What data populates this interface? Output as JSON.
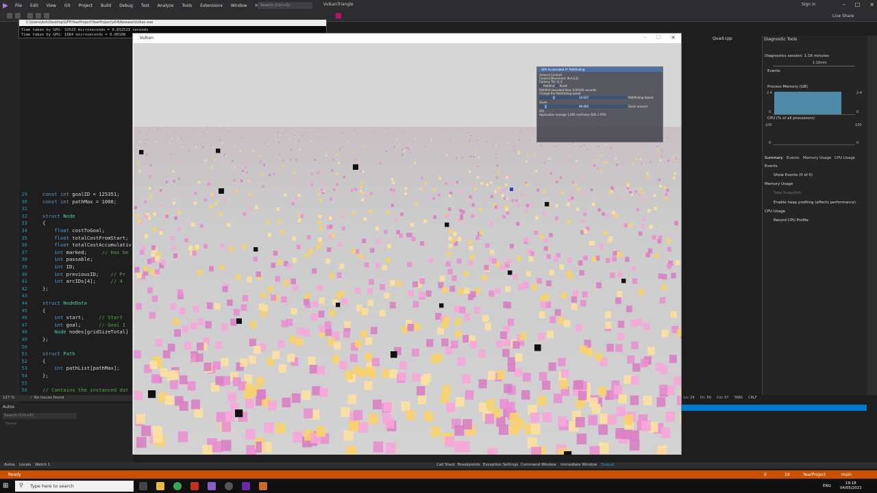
{
  "vs": {
    "menu": [
      "File",
      "Edit",
      "View",
      "Git",
      "Project",
      "Build",
      "Debug",
      "Test",
      "Analyze",
      "Tools",
      "Extensions",
      "Window",
      "Help"
    ],
    "search_placeholder": "Search (Ctrl+Q)",
    "title": "VulkanTriangle",
    "signin": "Sign in",
    "liveshare": "Live Share",
    "code_tab": "Quad.cpp"
  },
  "console": {
    "title": "C:\\Users\\Ash\\Desktop\\GFP\\YearProject\\YearProject\\x64\\Release\\Vulkan.exe",
    "lines": [
      "Time taken by GPU: 32523 microseconds = 0.032523 seconds",
      "Time taken by GPU: 1084 microseconds = 0.00108"
    ]
  },
  "vulkan": {
    "title": "Vulkan"
  },
  "imgui": {
    "title": "GPU Accelerated A* Pathfinding",
    "lines": [
      "General Controls",
      "Camera Movement: W,A,S,D",
      "Camera Tilt: Q, E",
      "Pathfind",
      "Reset",
      "Pathfind executed time: 0.00100 seconds",
      "Change the Pathfinding speed"
    ],
    "speed_value": "14.625",
    "speed_label": "Pathfinding Speed",
    "zoom_header": "Zoom",
    "zoom_value": "99.000",
    "zoom_label": "Zoom amount",
    "fps_label": "FPS",
    "fps_line": "Application average 1.692 ms/frame (591.1 FPS)"
  },
  "code": [
    {
      "ln": "29",
      "parts": [
        [
          "kw",
          "const "
        ],
        [
          "kw",
          "int "
        ],
        [
          "tx",
          "goalID = 125351;"
        ]
      ]
    },
    {
      "ln": "30",
      "parts": [
        [
          "kw",
          "const "
        ],
        [
          "kw",
          "int "
        ],
        [
          "tx",
          "pathMax = 1000;"
        ]
      ]
    },
    {
      "ln": "31",
      "parts": []
    },
    {
      "ln": "32",
      "parts": [
        [
          "kw",
          "struct "
        ],
        [
          "ty",
          "Node"
        ]
      ]
    },
    {
      "ln": "33",
      "parts": [
        [
          "tx",
          "{"
        ]
      ]
    },
    {
      "ln": "34",
      "parts": [
        [
          "tx",
          "    "
        ],
        [
          "kw",
          "float "
        ],
        [
          "tx",
          "costToGoal;"
        ]
      ]
    },
    {
      "ln": "35",
      "parts": [
        [
          "tx",
          "    "
        ],
        [
          "kw",
          "float "
        ],
        [
          "tx",
          "totalCostFromStart;"
        ]
      ]
    },
    {
      "ln": "36",
      "parts": [
        [
          "tx",
          "    "
        ],
        [
          "kw",
          "float "
        ],
        [
          "tx",
          "totalCostAccumulativ"
        ]
      ]
    },
    {
      "ln": "37",
      "parts": [
        [
          "tx",
          "    "
        ],
        [
          "kw",
          "int "
        ],
        [
          "tx",
          "marked;     "
        ],
        [
          "cm",
          "// Has be"
        ]
      ]
    },
    {
      "ln": "38",
      "parts": [
        [
          "tx",
          "    "
        ],
        [
          "kw",
          "int "
        ],
        [
          "tx",
          "passable;"
        ]
      ]
    },
    {
      "ln": "39",
      "parts": [
        [
          "tx",
          "    "
        ],
        [
          "kw",
          "int "
        ],
        [
          "tx",
          "ID;"
        ]
      ]
    },
    {
      "ln": "40",
      "parts": [
        [
          "tx",
          "    "
        ],
        [
          "kw",
          "int "
        ],
        [
          "tx",
          "previousID;    "
        ],
        [
          "cm",
          "// Pr"
        ]
      ]
    },
    {
      "ln": "41",
      "parts": [
        [
          "tx",
          "    "
        ],
        [
          "kw",
          "int "
        ],
        [
          "tx",
          "arcIDs[4];     "
        ],
        [
          "cm",
          "// 4"
        ]
      ]
    },
    {
      "ln": "42",
      "parts": [
        [
          "tx",
          "};"
        ]
      ]
    },
    {
      "ln": "43",
      "parts": []
    },
    {
      "ln": "44",
      "parts": [
        [
          "kw",
          "struct "
        ],
        [
          "ty",
          "NodeData"
        ]
      ]
    },
    {
      "ln": "45",
      "parts": [
        [
          "tx",
          "{"
        ]
      ]
    },
    {
      "ln": "46",
      "parts": [
        [
          "tx",
          "    "
        ],
        [
          "kw",
          "int "
        ],
        [
          "tx",
          "start;     "
        ],
        [
          "cm",
          "// Start"
        ]
      ]
    },
    {
      "ln": "47",
      "parts": [
        [
          "tx",
          "    "
        ],
        [
          "kw",
          "int "
        ],
        [
          "tx",
          "goal;      "
        ],
        [
          "cm",
          "// Goal I"
        ]
      ]
    },
    {
      "ln": "48",
      "parts": [
        [
          "tx",
          "    "
        ],
        [
          "ty",
          "Node "
        ],
        [
          "tx",
          "nodes[gridSizeTotal]"
        ]
      ]
    },
    {
      "ln": "49",
      "parts": [
        [
          "tx",
          "};"
        ]
      ]
    },
    {
      "ln": "50",
      "parts": []
    },
    {
      "ln": "51",
      "parts": [
        [
          "kw",
          "struct "
        ],
        [
          "ty",
          "Path"
        ]
      ]
    },
    {
      "ln": "52",
      "parts": [
        [
          "tx",
          "{"
        ]
      ]
    },
    {
      "ln": "53",
      "parts": [
        [
          "tx",
          "    "
        ],
        [
          "kw",
          "int "
        ],
        [
          "tx",
          "pathList[pathMax];"
        ]
      ]
    },
    {
      "ln": "54",
      "parts": [
        [
          "tx",
          "};"
        ]
      ]
    },
    {
      "ln": "55",
      "parts": []
    },
    {
      "ln": "56",
      "parts": [
        [
          "cm",
          "// Contains the instanced dat"
        ]
      ]
    }
  ],
  "editor_status": {
    "zoom": "127 %",
    "issues": "No issues found"
  },
  "autos": {
    "title": "Autos",
    "search": "Search (Ctrl+E)",
    "col_name": "Name"
  },
  "bottom_tabs_left": [
    "Autos",
    "Locals",
    "Watch 1"
  ],
  "bottom_tabs_right": [
    "Call Stack",
    "Breakpoints",
    "Exception Settings",
    "Command Window",
    "Immediate Window",
    "Output"
  ],
  "editor_pos": {
    "ln": "Ln: 29",
    "ch": "Ch: 50",
    "col": "Col: 57",
    "tabs": "TABS",
    "crlf": "CRLF"
  },
  "statusbar": {
    "ready": "Ready",
    "errors": "0",
    "warnings": "19",
    "project": "YearProject",
    "branch": "main"
  },
  "diag": {
    "title": "Diagnostic Tools",
    "session": "Diagnostics session: 1:16 minutes",
    "time": "1:10min",
    "events": "Events",
    "process_memory": "Process Memory (GB)",
    "mem_top": "2.4",
    "mem_bottom": "0",
    "cpu": "CPU (% of all processors)",
    "cpu_top": "100",
    "cpu_bottom": "0",
    "tabs": [
      "Summary",
      "Events",
      "Memory Usage",
      "CPU Usage"
    ],
    "sec_events": "Events",
    "show_events": "Show Events (0 of 0)",
    "sec_memory": "Memory Usage",
    "take_snapshot": "Take Snapshot",
    "heap_profiling": "Enable heap profiling (affects performance)",
    "sec_cpu": "CPU Usage",
    "record_cpu": "Record CPU Profile",
    "memory_fill_fraction": 1.0
  },
  "taskbar": {
    "search": "Type here to search",
    "time": "19:18",
    "date": "04/05/2021",
    "lang": "ENG"
  },
  "colors": {
    "vs_bg": "#1e1e1e",
    "status_orange": "#ca5100",
    "accent_blue": "#007acc",
    "imgui_title": "#4e6fa4"
  }
}
